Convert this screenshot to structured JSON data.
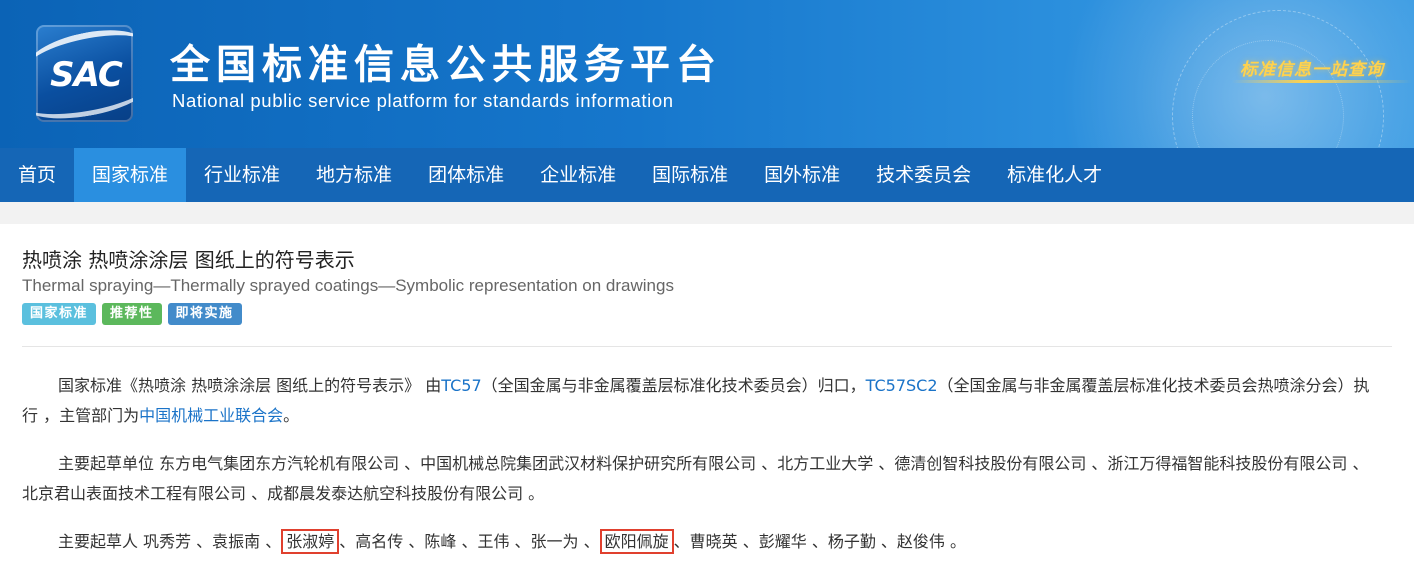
{
  "header": {
    "logo_text": "SAC",
    "title": "全国标准信息公共服务平台",
    "subtitle": "National public service platform  for standards information",
    "slogan": "标准信息一站查询"
  },
  "nav": {
    "items": [
      "首页",
      "国家标准",
      "行业标准",
      "地方标准",
      "团体标准",
      "企业标准",
      "国际标准",
      "国外标准",
      "技术委员会",
      "标准化人才"
    ],
    "active_index": 1
  },
  "standard": {
    "title_cn": "热喷涂 热喷涂涂层 图纸上的符号表示",
    "title_en": "Thermal spraying—Thermally sprayed coatings—Symbolic representation on drawings",
    "tags": [
      {
        "label": "国家标准",
        "color": "#5bc0de"
      },
      {
        "label": "推荐性",
        "color": "#5cb85c"
      },
      {
        "label": "即将实施",
        "color": "#428bca"
      }
    ]
  },
  "para1": {
    "t1": "国家标准《热喷涂 热喷涂涂层 图纸上的符号表示》 由",
    "link_tc": "TC57",
    "t2": "（全国金属与非金属覆盖层标准化技术委员会）归口，",
    "link_sc": "TC57SC2",
    "t3": "（全国金属与非金属覆盖层标准化技术委员会热喷涂分会）执行 ，主管部门为",
    "link_dept": "中国机械工业联合会",
    "t4": "。"
  },
  "para2": {
    "text": "主要起草单位 东方电气集团东方汽轮机有限公司 、中国机械总院集团武汉材料保护研究所有限公司 、北方工业大学 、德清创智科技股份有限公司 、浙江万得福智能科技股份有限公司 、北京君山表面技术工程有限公司 、成都晨发泰达航空科技股份有限公司 。"
  },
  "para3": {
    "t1": "主要起草人 巩秀芳 、袁振南 、",
    "h1": "张淑婷",
    "t2": "、高名传 、陈峰 、王伟 、张一为 、",
    "h2": "欧阳佩旋",
    "t3": "、曹晓英 、彭耀华 、杨子勤 、赵俊伟 。"
  },
  "colors": {
    "banner": "#1677cc",
    "nav": "#1566b6",
    "nav_active": "#2a8fe0",
    "link": "#1a73c8",
    "highlight_border": "#e0402e"
  }
}
